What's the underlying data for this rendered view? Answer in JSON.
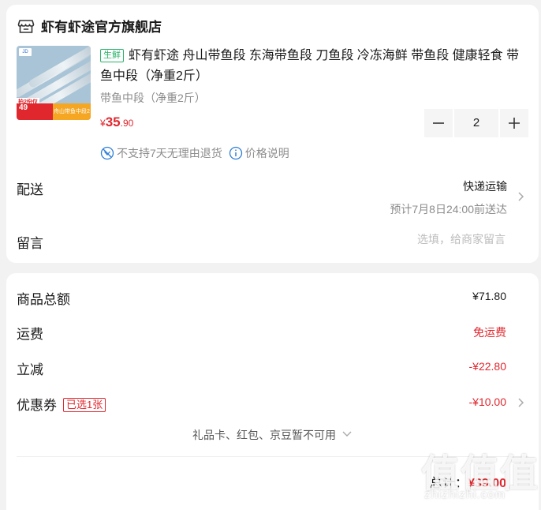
{
  "shop": {
    "name": "虾有虾途官方旗舰店",
    "icon": "store-icon"
  },
  "product": {
    "image_text": {
      "top_label": "拍2份仅",
      "price": "49",
      "badge_label_1": "京东好店",
      "badge_label_2": "舟山带鱼中段2斤"
    },
    "tag": "生鲜",
    "title": "虾有虾途 舟山带鱼段 东海带鱼段 刀鱼段 冷冻海鲜 带鱼段 健康轻食 带鱼中段（净重2斤）",
    "spec": "带鱼中段（净重2斤）",
    "price_symbol": "¥",
    "price_int": "35",
    "price_dec": ".90",
    "quantity": "2",
    "no_return_note": "不支持7天无理由退货",
    "price_note": "价格说明"
  },
  "delivery": {
    "label": "配送",
    "method": "快递运输",
    "eta": "预计7月8日24:00前送达"
  },
  "message": {
    "label": "留言",
    "placeholder": "选填，给商家留言"
  },
  "summary": {
    "goods_total_label": "商品总额",
    "goods_total_value": "¥71.80",
    "freight_label": "运费",
    "freight_value": "免运费",
    "discount_label": "立减",
    "discount_value": "-¥22.80",
    "coupon_label": "优惠券",
    "coupon_tag": "已选1张",
    "coupon_value": "-¥10.00",
    "unavailable_note": "礼品卡、红包、京豆暂不可用",
    "total_label": "总计：",
    "total_value": "¥39.00"
  },
  "watermark": {
    "big": "值值值",
    "small": "zhizhizhi.com"
  },
  "colors": {
    "accent_red": "#e0272e",
    "fresh_green": "#29b36a",
    "muted": "#8c8c8c"
  }
}
